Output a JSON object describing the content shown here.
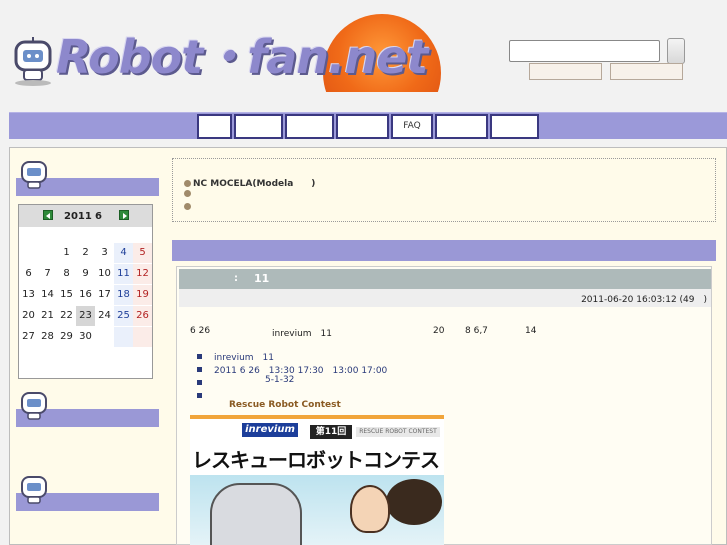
{
  "header": {
    "site_name": "Robot・fan.net",
    "search": {
      "placeholder": "",
      "value": ""
    },
    "buttons": [
      "",
      ""
    ]
  },
  "nav": {
    "tabs": [
      {
        "label": ""
      },
      {
        "label": ""
      },
      {
        "label": ""
      },
      {
        "label": ""
      },
      {
        "label": "FAQ"
      },
      {
        "label": ""
      },
      {
        "label": ""
      }
    ]
  },
  "sidebar": {
    "calendar": {
      "year": "2011",
      "month": "6",
      "weeks": [
        [
          "",
          "",
          "",
          "1",
          "2",
          "3",
          "4",
          "5"
        ],
        [
          "6",
          "7",
          "8",
          "9",
          "10",
          "11",
          "12"
        ],
        [
          "13",
          "14",
          "15",
          "16",
          "17",
          "18",
          "19"
        ],
        [
          "20",
          "21",
          "22",
          "23",
          "24",
          "25",
          "26"
        ],
        [
          "27",
          "28",
          "29",
          "30",
          "",
          "",
          ""
        ]
      ],
      "today": "23"
    }
  },
  "notices": [
    {
      "text": "NC MOCELA(Modela　　)"
    },
    {
      "text": ""
    },
    {
      "text": ""
    }
  ],
  "article": {
    "title_prefix": ":",
    "title_number": "11",
    "date": "2011-06-20 16:03:12 (49　)",
    "intro": {
      "a": "6 26",
      "b": "inrevium　11",
      "c": "20",
      "d": "8 6,7",
      "e": "14"
    },
    "list": [
      {
        "text": "inrevium　11"
      },
      {
        "text": "2011 6 26　13:30 17:30　13:00 17:00"
      },
      {
        "text": "5-1-32"
      },
      {
        "text": ""
      }
    ],
    "link_text": "Rescue Robot Contest",
    "banner": {
      "brand": "inrevium",
      "edition": "第11回",
      "contest": "RESCUE ROBOT CONTEST",
      "headline": "レスキューロボットコンテスト"
    }
  },
  "colors": {
    "nav_bar": "#9b99d9",
    "section_bar": "#9a98d6",
    "content_bg": "#fffbea",
    "logo_text": "#8d88cc",
    "sun": "#f06a18"
  },
  "icons": [
    "robot-mascot-icon",
    "search-icon",
    "calendar-prev-icon",
    "calendar-next-icon",
    "bullet-icon"
  ]
}
